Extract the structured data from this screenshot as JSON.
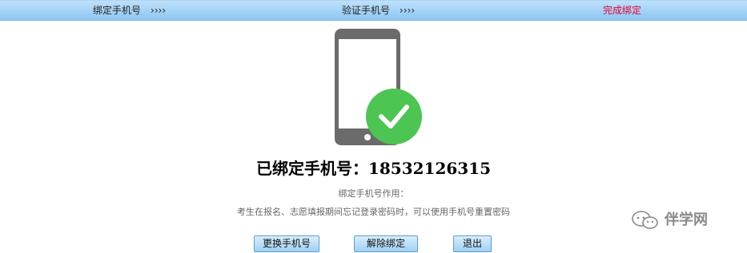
{
  "steps": [
    {
      "label": "绑定手机号",
      "arrows": "››››"
    },
    {
      "label": "验证手机号",
      "arrows": "››››"
    },
    {
      "label": "完成绑定"
    }
  ],
  "status": {
    "bound_text": "已绑定手机号：18532126315"
  },
  "purpose": {
    "title": "绑定手机号作用：",
    "description": "考生在报名、志愿填报期间忘记登录密码时，可以使用手机号重置密码"
  },
  "buttons": {
    "change": "更换手机号",
    "unbind": "解除绑定",
    "exit": "退出"
  },
  "watermark": {
    "text": "伴学网"
  },
  "colors": {
    "step_bar": "#8cc6f2",
    "active_step": "#e8002d",
    "phone": "#6b6b6b",
    "check_badge": "#4cc552"
  },
  "icons": {
    "phone": "smartphone-icon",
    "check": "check-circle-icon",
    "watermark": "wechat-icon"
  }
}
